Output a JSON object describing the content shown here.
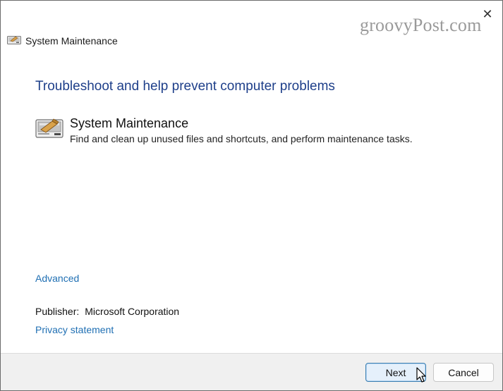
{
  "window": {
    "title": "System Maintenance",
    "close_symbol": "✕"
  },
  "watermark": "groovyPost.com",
  "main": {
    "heading": "Troubleshoot and help prevent computer problems",
    "task": {
      "title": "System Maintenance",
      "description": "Find and clean up unused files and shortcuts, and perform maintenance tasks.",
      "icon": "system-maintenance-icon"
    },
    "advanced_link": "Advanced",
    "publisher_label": "Publisher:",
    "publisher_value": "Microsoft Corporation",
    "privacy_link": "Privacy statement"
  },
  "footer": {
    "next_label": "Next",
    "cancel_label": "Cancel"
  },
  "colors": {
    "heading": "#1e3f8a",
    "link": "#1f6fb3",
    "primary_button_border": "#3c7fb1"
  }
}
